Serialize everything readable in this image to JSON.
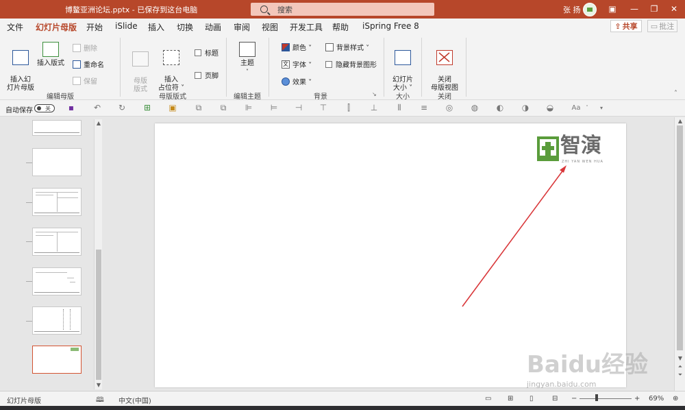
{
  "titlebar": {
    "doc_title": "博鳌亚洲论坛.pptx  -  已保存到这台电脑",
    "search_placeholder": "搜索",
    "user_name": "张 扬"
  },
  "menu": {
    "tabs": [
      "文件",
      "幻灯片母版",
      "开始",
      "iSlide",
      "插入",
      "切换",
      "动画",
      "审阅",
      "视图",
      "开发工具",
      "帮助",
      "iSpring Free 8"
    ],
    "active_tab": "幻灯片母版",
    "share_label": "共享",
    "comment_label": "批注"
  },
  "ribbon": {
    "edit_master": {
      "insert_master": "插入幻\n灯片母版",
      "insert_layout": "插入版式",
      "delete": "删除",
      "rename": "重命名",
      "preserve": "保留",
      "group_label": "编辑母版"
    },
    "master_layout": {
      "master_layout_btn": "母版\n版式",
      "insert_placeholder": "插入\n占位符 ˅",
      "title_check": "标题",
      "footer_check": "页脚",
      "group_label": "母版版式"
    },
    "edit_theme": {
      "themes": "主题",
      "group_label": "编辑主题"
    },
    "background": {
      "colors": "颜色 ˅",
      "fonts": "字体 ˅",
      "effects": "效果 ˅",
      "bg_styles": "背景样式 ˅",
      "hide_bg": "隐藏背景图形",
      "group_label": "背景"
    },
    "size": {
      "slide_size": "幻灯片\n大小 ˅",
      "group_label": "大小"
    },
    "close": {
      "close_master": "关闭\n母版视图",
      "group_label": "关闭"
    }
  },
  "qat": {
    "autosave_label": "自动保存",
    "autosave_state": "关"
  },
  "slide": {
    "logo_text": "智演",
    "logo_sub": "ZHI YAN WEN HUA"
  },
  "statusbar": {
    "view_name": "幻灯片母版",
    "language": "中文(中国)",
    "zoom": "69%"
  },
  "watermark": {
    "brand": "Baidu经验",
    "url": "jingyan.baidu.com"
  },
  "colors": {
    "accent": "#b7472a",
    "logo_green": "#5a9c3b",
    "arrow_red": "#d9373a"
  }
}
